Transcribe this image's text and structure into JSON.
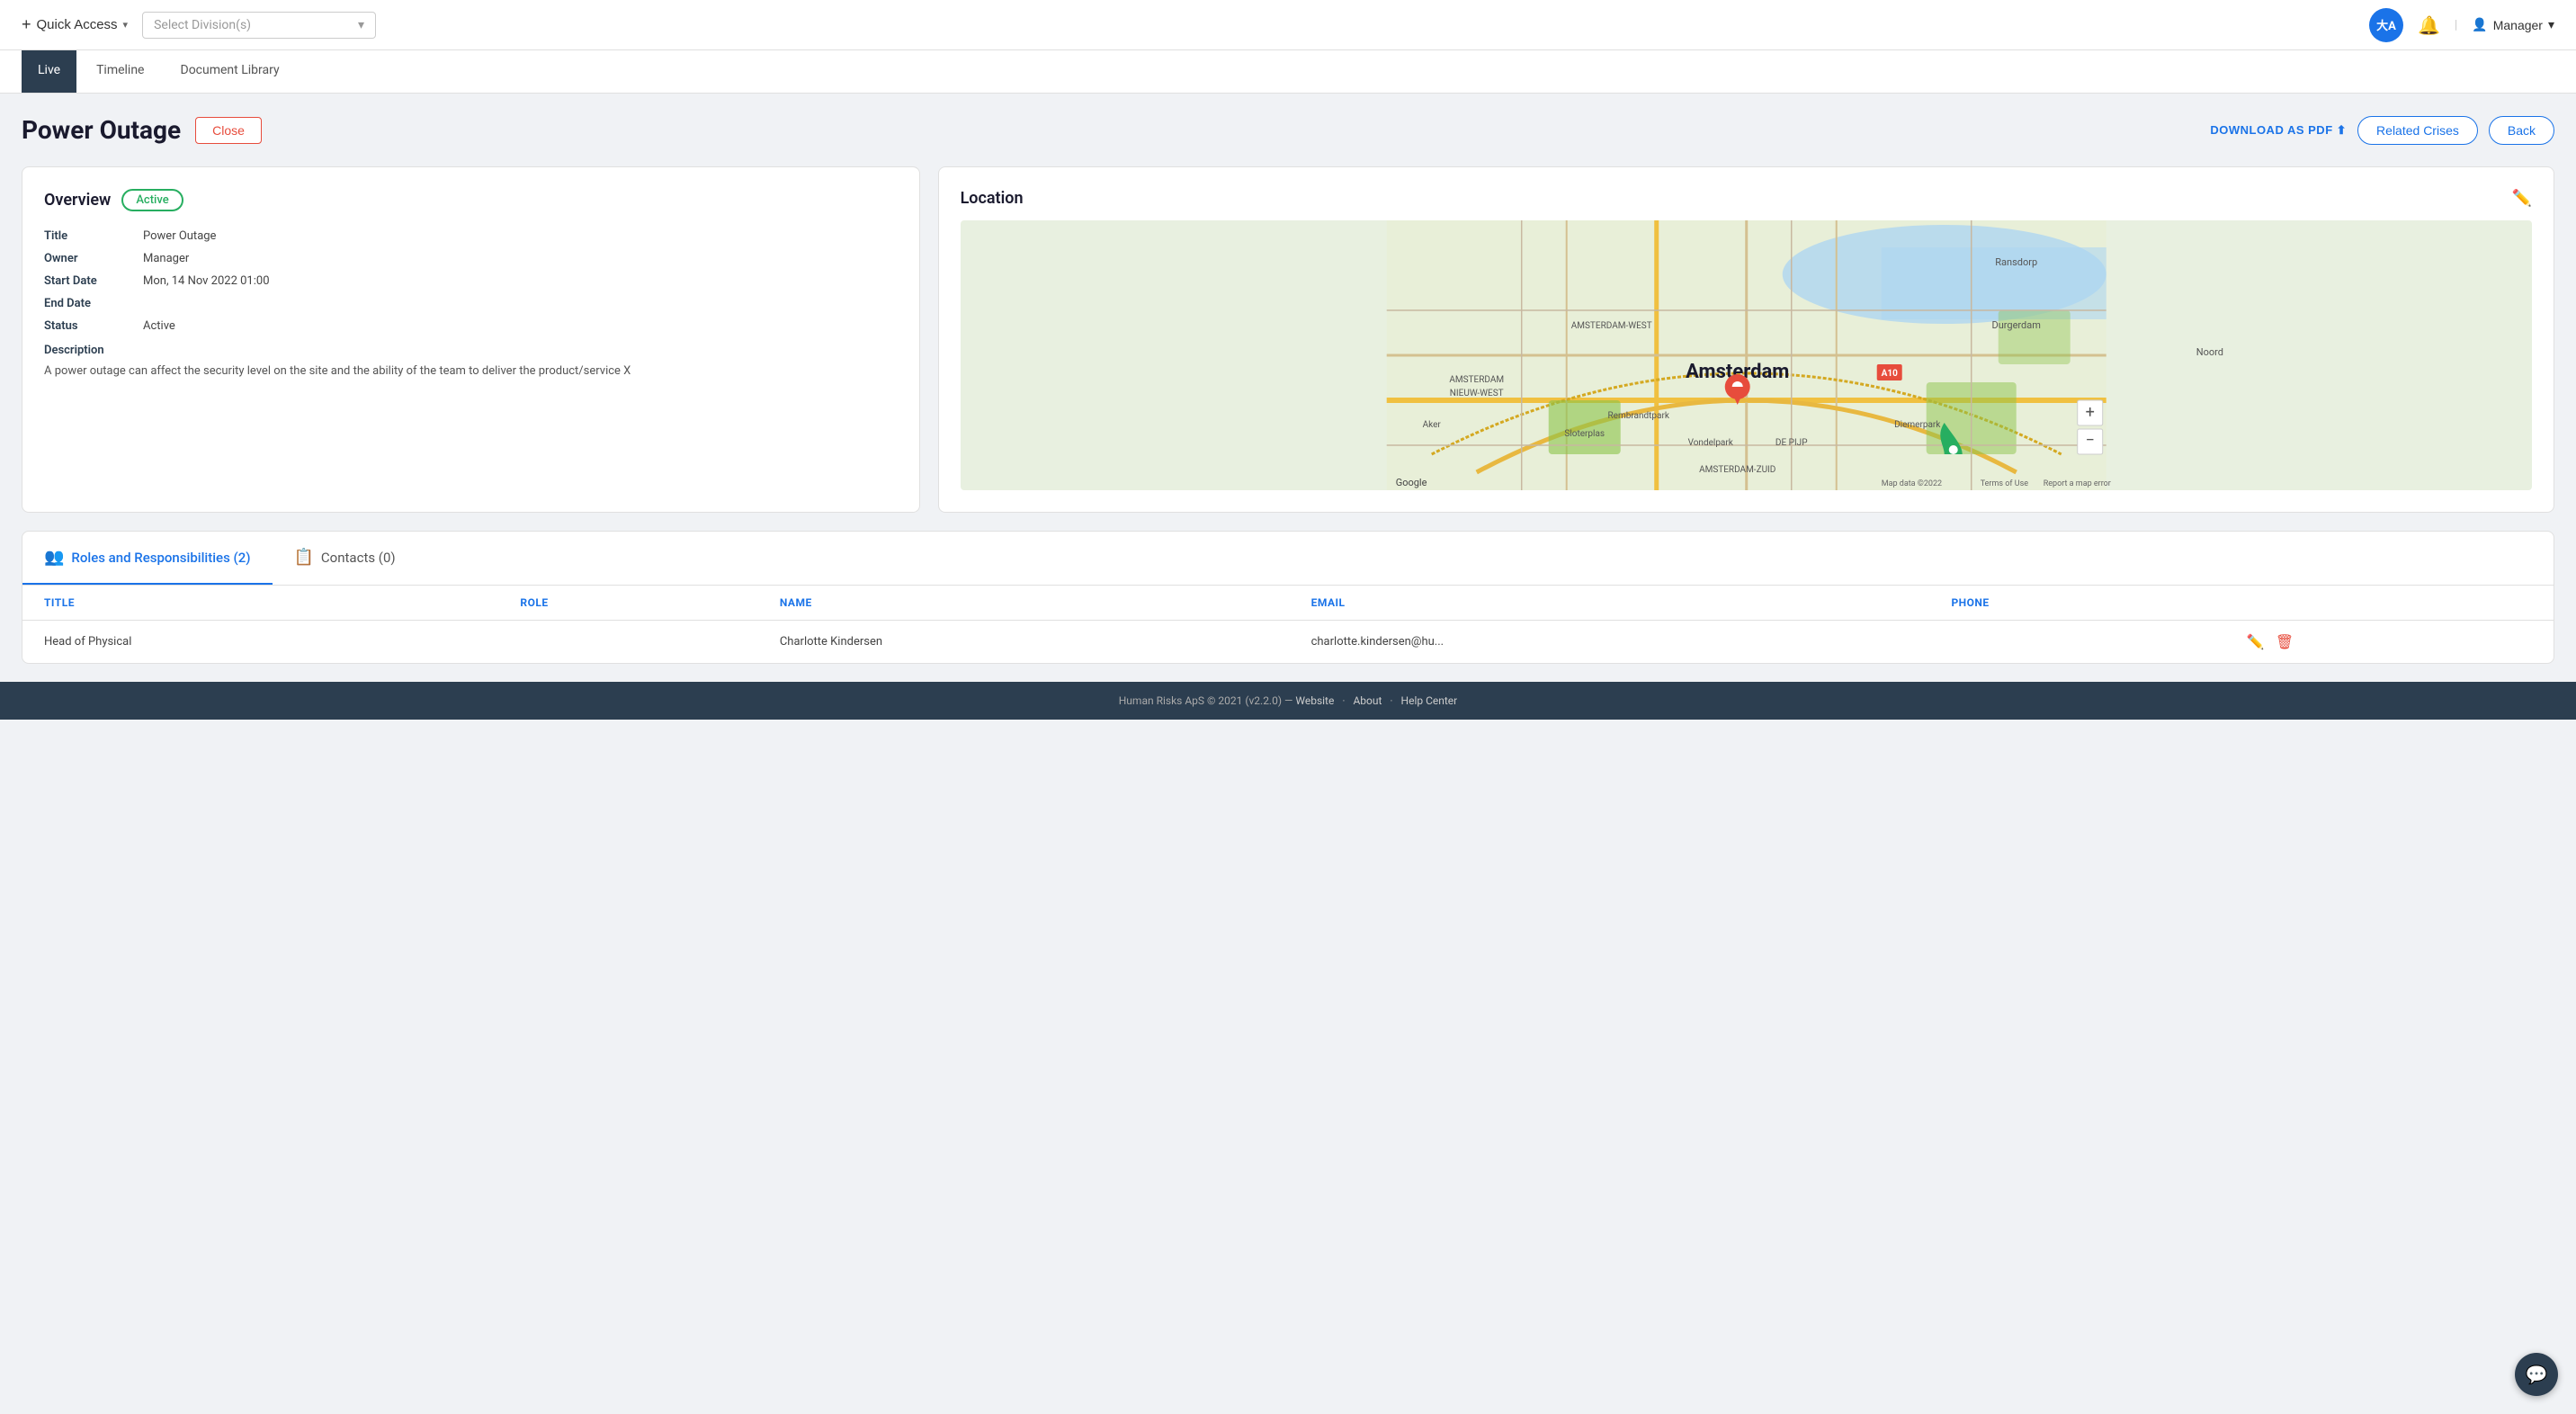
{
  "header": {
    "quick_access_label": "Quick Access",
    "division_placeholder": "Select Division(s)",
    "avatar_text": "大A",
    "notifications_icon": "bell",
    "user_label": "Manager"
  },
  "tabs": [
    {
      "id": "live",
      "label": "Live",
      "active": true
    },
    {
      "id": "timeline",
      "label": "Timeline",
      "active": false
    },
    {
      "id": "document-library",
      "label": "Document Library",
      "active": false
    }
  ],
  "page": {
    "title": "Power Outage",
    "close_label": "Close",
    "download_pdf_label": "DOWNLOAD AS PDF",
    "related_crises_label": "Related Crises",
    "back_label": "Back"
  },
  "overview": {
    "title": "Overview",
    "status_badge": "Active",
    "fields": {
      "title_label": "Title",
      "title_value": "Power Outage",
      "owner_label": "Owner",
      "owner_value": "Manager",
      "start_date_label": "Start Date",
      "start_date_value": "Mon, 14 Nov 2022 01:00",
      "end_date_label": "End Date",
      "end_date_value": "",
      "status_label": "Status",
      "status_value": "Active",
      "description_label": "Description",
      "description_text": "A power outage can affect the security level on the site and the ability of the team to deliver the product/service X"
    }
  },
  "location": {
    "title": "Location",
    "map_center": "Amsterdam"
  },
  "roles": {
    "tab_label": "Roles and Responsibilities (2)",
    "contacts_tab_label": "Contacts (0)",
    "columns": {
      "title": "TITLE",
      "role": "ROLE",
      "name": "NAME",
      "email": "EMAIL",
      "phone": "PHONE"
    },
    "rows": [
      {
        "title": "Head of Physical",
        "role": "",
        "name": "Charlotte Kindersen",
        "email": "charlotte.kindersen@hu...",
        "phone": ""
      }
    ]
  },
  "footer": {
    "copyright": "Human Risks ApS © 2021 (v2.2.0)",
    "dash": "—",
    "website_label": "Website",
    "about_label": "About",
    "help_label": "Help Center"
  }
}
